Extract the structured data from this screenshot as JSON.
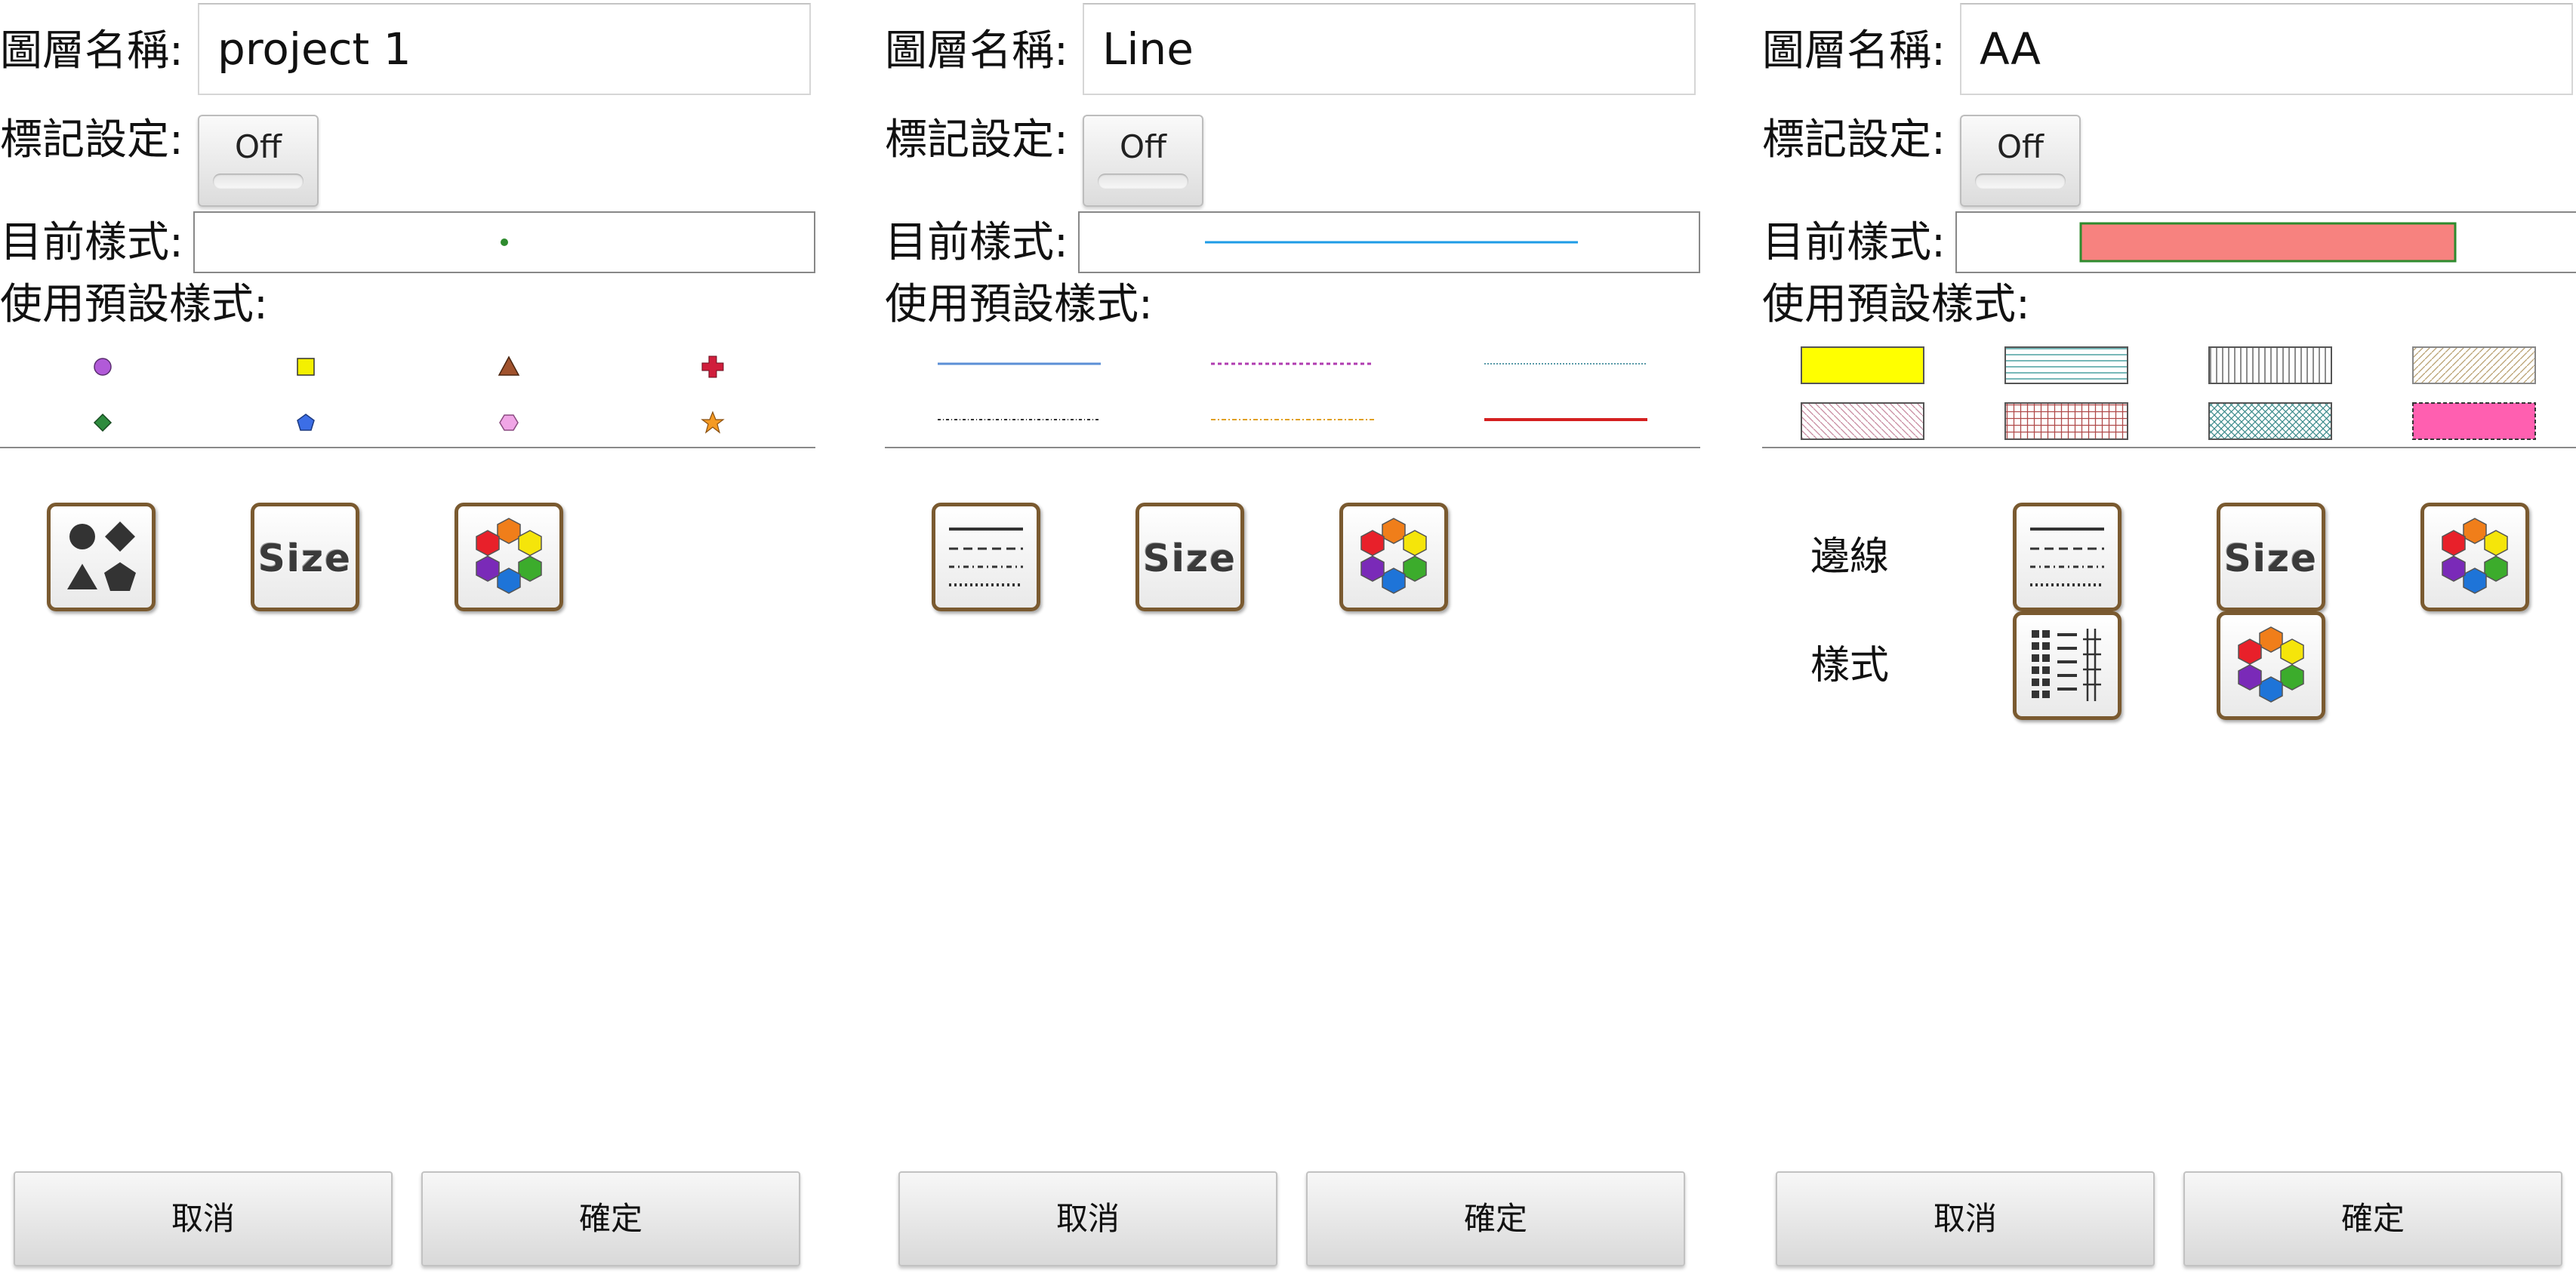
{
  "labels": {
    "layer_name": "圖層名稱:",
    "marker_setting": "標記設定:",
    "current_style": "目前樣式:",
    "use_preset": "使用預設樣式:"
  },
  "toggle_text": "Off",
  "buttons": {
    "cancel": "取消",
    "ok": "確定"
  },
  "panels": [
    {
      "layer_name": "project 1",
      "type": "point",
      "current_style_color": "#2e8b2e",
      "preset_icons": [
        "circle-marker-icon",
        "square-marker-icon",
        "triangle-marker-icon",
        "cross-marker-icon",
        "diamond-marker-icon",
        "pentagon-marker-icon",
        "hexagon-marker-icon",
        "star-marker-icon"
      ],
      "tools": [
        "shape-picker-icon",
        "size-icon",
        "color-picker-icon"
      ]
    },
    {
      "layer_name": "Line",
      "type": "line",
      "current_style_color": "#1e9be6",
      "preset_icons": [
        "solid-line-icon",
        "dotted-line-icon",
        "fine-dotted-line-icon",
        "dash-dot-line-icon",
        "dashed-line-icon",
        "thick-solid-line-icon"
      ],
      "tools": [
        "line-style-icon",
        "size-icon",
        "color-picker-icon"
      ]
    },
    {
      "layer_name": "AA",
      "type": "polygon",
      "current_style_color": "#f7827f",
      "current_style_border": "#2e8b2e",
      "preset_icons": [
        "solid-fill-icon",
        "horizontal-hatch-icon",
        "vertical-hatch-icon",
        "diagonal-hatch-icon",
        "reverse-diagonal-hatch-icon",
        "grid-hatch-icon",
        "cross-hatch-icon",
        "dashed-border-fill-icon"
      ],
      "rows": [
        "邊線",
        "樣式"
      ],
      "tools": [
        "line-style-icon",
        "size-icon",
        "color-picker-icon",
        "fill-pattern-icon",
        "color-picker-icon"
      ]
    }
  ]
}
